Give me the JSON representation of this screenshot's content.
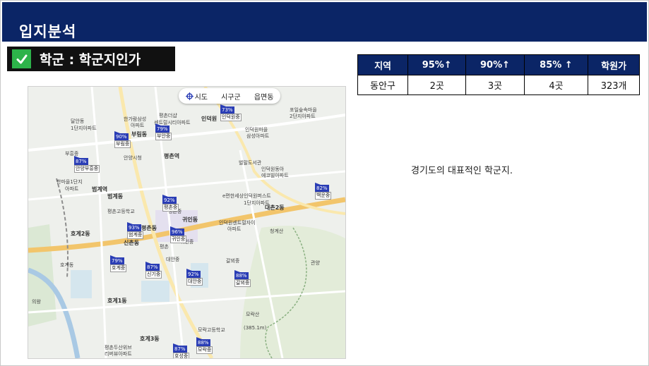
{
  "header": {
    "title": "입지분석"
  },
  "section": {
    "title": "학군 : 학군지인가"
  },
  "map": {
    "controls": [
      {
        "icon": "location-target-icon",
        "label": "시도"
      },
      {
        "label": "시구군"
      },
      {
        "label": "읍면동"
      }
    ],
    "places": [
      "한가람삼성",
      "아파트",
      "평촌더샵",
      "센트럴시티아파트",
      "인덕원",
      "포일숲속마을",
      "2단지아파트",
      "부림동",
      "부흥중",
      "달안동",
      "1단지아파트",
      "안양시청",
      "평촌역",
      "인덕원마을",
      "삼성아파트",
      "범계역",
      "한마을1단지",
      "아파트",
      "벌말도서관",
      "인덕원동아",
      "에코빌아파트",
      "범계동",
      "평촌고등학교",
      "평촌중",
      "e편한세상인덕원퍼스트",
      "1단지아파트",
      "대촌2동",
      "귀인동",
      "호계2동",
      "평촌동",
      "인덕원센트럴자이",
      "아파트",
      "신촌동",
      "청계산",
      "호계3동",
      "호계1동",
      "평촌두산위브",
      "리버뷰아파트",
      "모락고등학교",
      "모락산",
      "(385.1m)",
      "갈뫼중",
      "대안중",
      "호계동",
      "평촌",
      "귀인중",
      "관양",
      "의왕"
    ],
    "markers": [
      {
        "pct": "73%",
        "name": "인덕원중"
      },
      {
        "pct": "79%",
        "name": "부안중"
      },
      {
        "pct": "90%",
        "name": "부림중"
      },
      {
        "pct": "87%",
        "name": "안양부흥중"
      },
      {
        "pct": "82%",
        "name": "백운중"
      },
      {
        "pct": "92%",
        "name": "평촌중"
      },
      {
        "pct": "93%",
        "name": "범계중"
      },
      {
        "pct": "96%",
        "name": "귀인중"
      },
      {
        "pct": "79%",
        "name": "호계중"
      },
      {
        "pct": "87%",
        "name": "신기중"
      },
      {
        "pct": "92%",
        "name": "대안중"
      },
      {
        "pct": "88%",
        "name": "갈뫼중"
      },
      {
        "pct": "88%",
        "name": "모락중"
      },
      {
        "pct": "87%",
        "name": "호성중"
      }
    ]
  },
  "table": {
    "headers": [
      "지역",
      "95%↑",
      "90%↑",
      "85% ↑",
      "학원가"
    ],
    "row": [
      "동안구",
      "2곳",
      "3곳",
      "4곳",
      "323개"
    ]
  },
  "note": "경기도의 대표적인 학군지.",
  "colors": {
    "header": "#0b2566",
    "check": "#2db34a",
    "marker": "#2a3db5"
  }
}
